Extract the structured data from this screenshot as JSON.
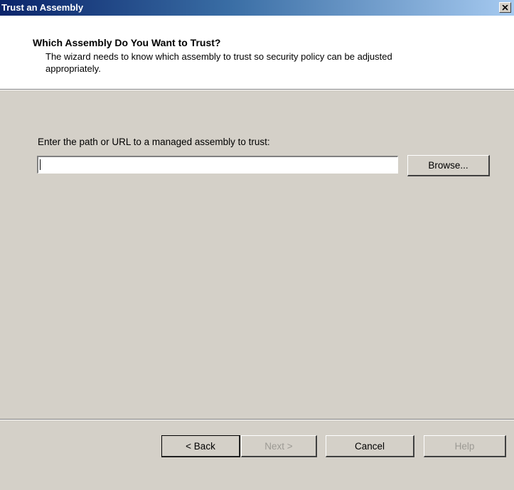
{
  "window": {
    "title": "Trust an Assembly",
    "close_icon": "close-x-icon"
  },
  "header": {
    "title": "Which Assembly Do You Want to Trust?",
    "description": "The wizard needs to know which assembly to trust so security policy can be adjusted appropriately."
  },
  "main": {
    "path_label": "Enter the path or URL to a managed assembly to trust:",
    "path_value": "",
    "browse_label": "Browse..."
  },
  "footer": {
    "back_label": "< Back",
    "next_label": "Next >",
    "cancel_label": "Cancel",
    "help_label": "Help"
  },
  "colors": {
    "title_gradient_start": "#0a246a",
    "title_gradient_end": "#a6caf0",
    "dialog_background": "#d4d0c8",
    "header_background": "#ffffff",
    "disabled_text": "#9c9a94"
  }
}
